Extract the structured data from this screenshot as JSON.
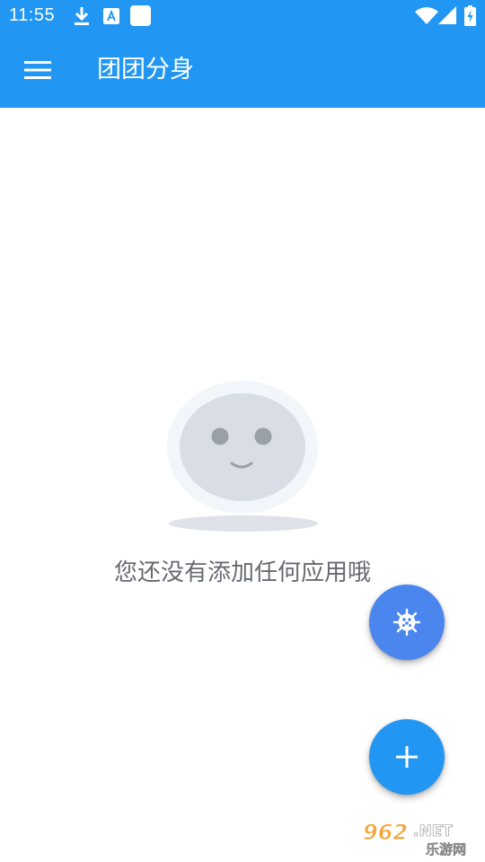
{
  "status_bar": {
    "time": "11:55",
    "icons": [
      "download-icon",
      "accessibility-font-icon",
      "square-notification-icon",
      "wifi-icon",
      "signal-icon",
      "battery-charging-icon"
    ],
    "color": "#2196f3"
  },
  "app_bar": {
    "title": "团团分身",
    "menu_icon": "hamburger-menu-icon",
    "color": "#2196f3"
  },
  "empty_state": {
    "illustration": "smiling-face-icon",
    "message": "您还没有添加任何应用哦"
  },
  "fabs": {
    "virus": {
      "icon": "virus-icon",
      "color": "#4a86ee"
    },
    "add": {
      "icon": "plus-icon",
      "color": "#2196f3"
    }
  },
  "watermark": {
    "brand": "962.NET",
    "brand_cn": "乐游网"
  }
}
